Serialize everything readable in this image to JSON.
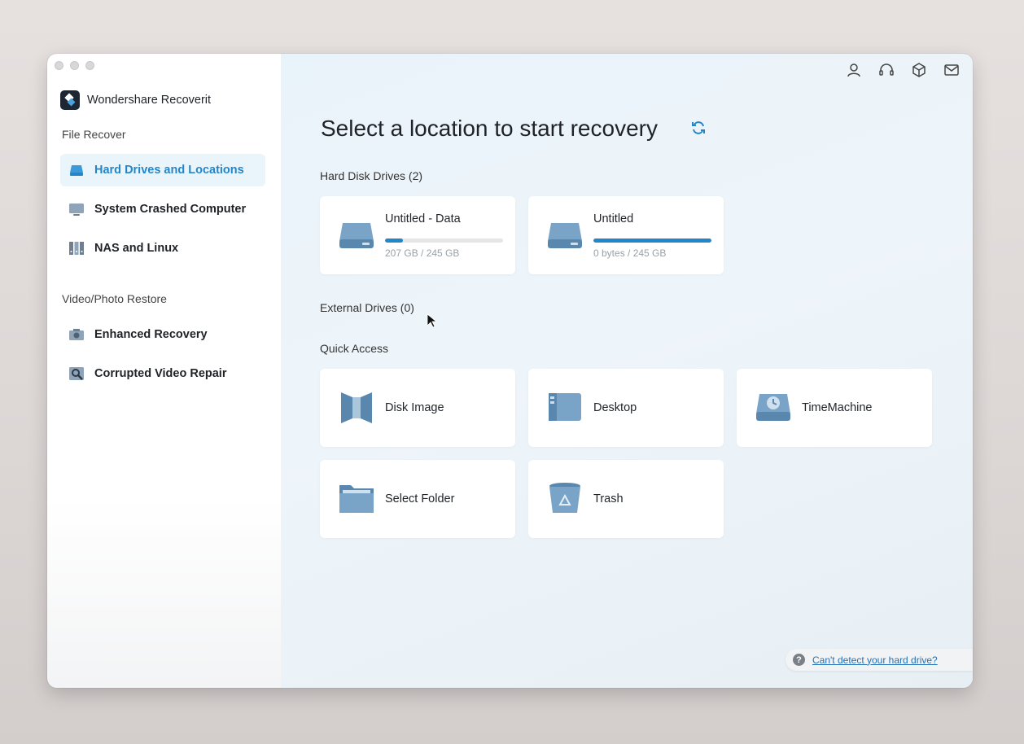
{
  "app": {
    "name": "Wondershare Recoverit"
  },
  "sidebar": {
    "file_recover_label": "File Recover",
    "video_photo_label": "Video/Photo Restore",
    "items": [
      {
        "label": "Hard Drives and Locations",
        "icon": "hard-drive-icon",
        "active": true
      },
      {
        "label": "System Crashed Computer",
        "icon": "monitor-icon",
        "active": false
      },
      {
        "label": "NAS and Linux",
        "icon": "nas-icon",
        "active": false
      },
      {
        "label": "Enhanced Recovery",
        "icon": "camera-icon",
        "active": false
      },
      {
        "label": "Corrupted Video Repair",
        "icon": "video-repair-icon",
        "active": false
      }
    ]
  },
  "header": {
    "icons": [
      "user-icon",
      "headset-icon",
      "box-icon",
      "mail-icon"
    ]
  },
  "main": {
    "title": "Select a location to start recovery",
    "hard_disk_label": "Hard Disk Drives (2)",
    "external_label": "External Drives (0)",
    "quick_access_label": "Quick Access",
    "drives": [
      {
        "name": "Untitled - Data",
        "size": "207 GB / 245 GB",
        "used_fraction": 0.15
      },
      {
        "name": "Untitled",
        "size": "0 bytes / 245 GB",
        "used_fraction": 1.0
      }
    ],
    "quick_access": [
      {
        "label": "Disk Image",
        "icon": "disk-image-icon"
      },
      {
        "label": "Desktop",
        "icon": "desktop-icon"
      },
      {
        "label": "TimeMachine",
        "icon": "time-machine-icon"
      },
      {
        "label": "Select Folder",
        "icon": "folder-icon"
      },
      {
        "label": "Trash",
        "icon": "trash-icon"
      }
    ],
    "help_link": "Can't detect your hard drive?"
  },
  "colors": {
    "accent": "#2486c9",
    "active_bg": "#eaf4fb"
  }
}
